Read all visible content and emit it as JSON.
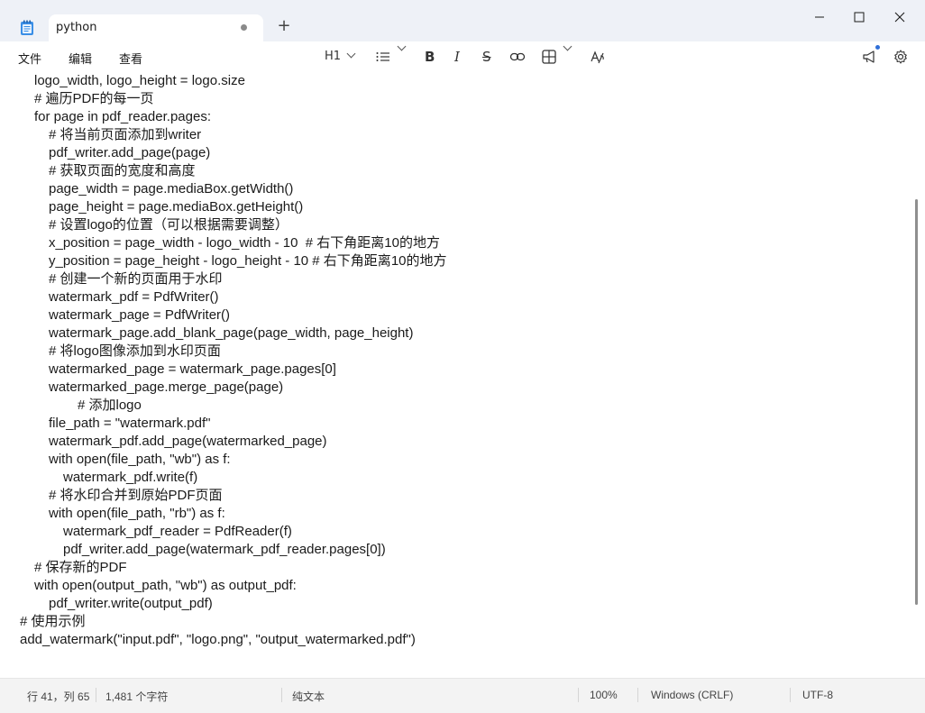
{
  "tab": {
    "title": "python",
    "modified": true
  },
  "new_tab_label": "+",
  "window_controls": {
    "minimize": "─",
    "maximize": "☐",
    "close": "✕"
  },
  "menu": {
    "file": "文件",
    "edit": "编辑",
    "view": "查看"
  },
  "toolbar": {
    "heading": "H1",
    "list_icon": "list-icon",
    "bold": "B",
    "italic": "I",
    "strike": "S",
    "link_icon": "link-icon",
    "table_icon": "table-icon",
    "spellcheck": "A͡",
    "announcement_icon": "megaphone-icon",
    "settings_icon": "gear-icon"
  },
  "code_lines": [
    {
      "indent": 1,
      "text": "logo_width, logo_height = logo.size"
    },
    {
      "indent": 1,
      "text": "# 遍历PDF的每一页"
    },
    {
      "indent": 1,
      "text": "for page in pdf_reader.pages:"
    },
    {
      "indent": 2,
      "text": "# 将当前页面添加到writer"
    },
    {
      "indent": 2,
      "text": "pdf_writer.add_page(page)"
    },
    {
      "indent": 2,
      "text": "# 获取页面的宽度和高度"
    },
    {
      "indent": 2,
      "text": "page_width = page.mediaBox.getWidth()"
    },
    {
      "indent": 2,
      "text": "page_height = page.mediaBox.getHeight()"
    },
    {
      "indent": 2,
      "text": "# 设置logo的位置（可以根据需要调整）"
    },
    {
      "indent": 2,
      "text": "x_position = page_width - logo_width - 10  # 右下角距离10的地方"
    },
    {
      "indent": 2,
      "text": "y_position = page_height - logo_height - 10 # 右下角距离10的地方"
    },
    {
      "indent": 2,
      "text": "# 创建一个新的页面用于水印"
    },
    {
      "indent": 2,
      "text": "watermark_pdf = PdfWriter()"
    },
    {
      "indent": 2,
      "text": "watermark_page = PdfWriter()"
    },
    {
      "indent": 2,
      "text": "watermark_page.add_blank_page(page_width, page_height)"
    },
    {
      "indent": 2,
      "text": "# 将logo图像添加到水印页面"
    },
    {
      "indent": 2,
      "text": "watermarked_page = watermark_page.pages[0]"
    },
    {
      "indent": 2,
      "text": "watermarked_page.merge_page(page)"
    },
    {
      "indent": 4,
      "text": "# 添加logo"
    },
    {
      "indent": 2,
      "text": "file_path = \"watermark.pdf\""
    },
    {
      "indent": 2,
      "text": "watermark_pdf.add_page(watermarked_page)"
    },
    {
      "indent": 2,
      "text": "with open(file_path, \"wb\") as f:"
    },
    {
      "indent": 3,
      "text": "watermark_pdf.write(f)"
    },
    {
      "indent": 2,
      "text": "# 将水印合并到原始PDF页面"
    },
    {
      "indent": 2,
      "text": "with open(file_path, \"rb\") as f:"
    },
    {
      "indent": 3,
      "text": "watermark_pdf_reader = PdfReader(f)"
    },
    {
      "indent": 3,
      "text": "pdf_writer.add_page(watermark_pdf_reader.pages[0])"
    },
    {
      "indent": 1,
      "text": "# 保存新的PDF"
    },
    {
      "indent": 1,
      "text": "with open(output_path, \"wb\") as output_pdf:"
    },
    {
      "indent": 2,
      "text": "pdf_writer.write(output_pdf)"
    },
    {
      "indent": 0,
      "text": "# 使用示例"
    },
    {
      "indent": 0,
      "text": "add_watermark(\"input.pdf\", \"logo.png\", \"output_watermarked.pdf\")"
    }
  ],
  "status": {
    "position": "行 41，列 65",
    "char_count": "1,481 个字符",
    "format": "纯文本",
    "zoom": "100%",
    "line_ending": "Windows (CRLF)",
    "encoding": "UTF-8"
  }
}
